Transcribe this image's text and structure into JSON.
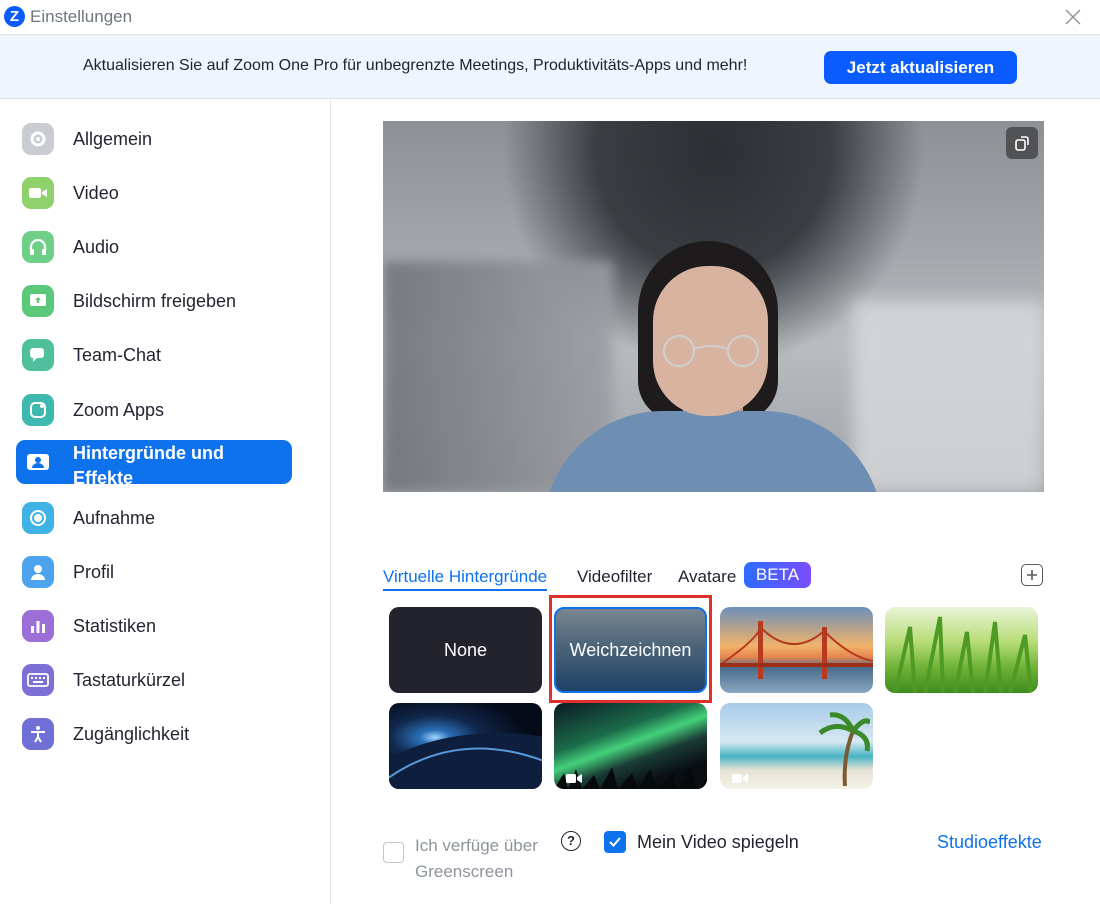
{
  "window": {
    "title": "Einstellungen",
    "logo": "Z"
  },
  "banner": {
    "text": "Aktualisieren Sie auf Zoom One Pro für unbegrenzte Meetings, Produktivitäts-Apps und mehr!",
    "button": "Jetzt aktualisieren"
  },
  "sidebar": {
    "items": [
      {
        "label": "Allgemein",
        "icon": "gear-icon",
        "color": "#c9ccd1"
      },
      {
        "label": "Video",
        "icon": "video-camera-icon",
        "color": "#8fd16a"
      },
      {
        "label": "Audio",
        "icon": "headphones-icon",
        "color": "#6fcf86"
      },
      {
        "label": "Bildschirm freigeben",
        "icon": "share-screen-icon",
        "color": "#5bc97a"
      },
      {
        "label": "Team-Chat",
        "icon": "chat-icon",
        "color": "#4fbf9c"
      },
      {
        "label": "Zoom Apps",
        "icon": "apps-icon",
        "color": "#3fb9b0"
      },
      {
        "label": "Hintergründe und Effekte",
        "icon": "background-icon",
        "color": "#ffffff",
        "active": true
      },
      {
        "label": "Aufnahme",
        "icon": "record-icon",
        "color": "#3fb3e6"
      },
      {
        "label": "Profil",
        "icon": "profile-icon",
        "color": "#4da3ec"
      },
      {
        "label": "Statistiken",
        "icon": "statistics-icon",
        "color": "#9b6fd6"
      },
      {
        "label": "Tastaturkürzel",
        "icon": "keyboard-icon",
        "color": "#7c6fd6"
      },
      {
        "label": "Zugänglichkeit",
        "icon": "accessibility-icon",
        "color": "#6f6fd6"
      }
    ]
  },
  "tabs": {
    "virtual": "Virtuelle Hintergründe",
    "filters": "Videofilter",
    "avatars": "Avatare",
    "beta": "BETA"
  },
  "backgrounds": {
    "none": "None",
    "blur": "Weichzeichnen"
  },
  "options": {
    "greenscreen": "Ich verfüge über Greenscreen",
    "mirror": "Mein Video spiegeln",
    "studio": "Studioeffekte"
  },
  "colors": {
    "accent": "#0e72ed",
    "highlight": "#e0302b",
    "brand": "#0b5cff"
  }
}
